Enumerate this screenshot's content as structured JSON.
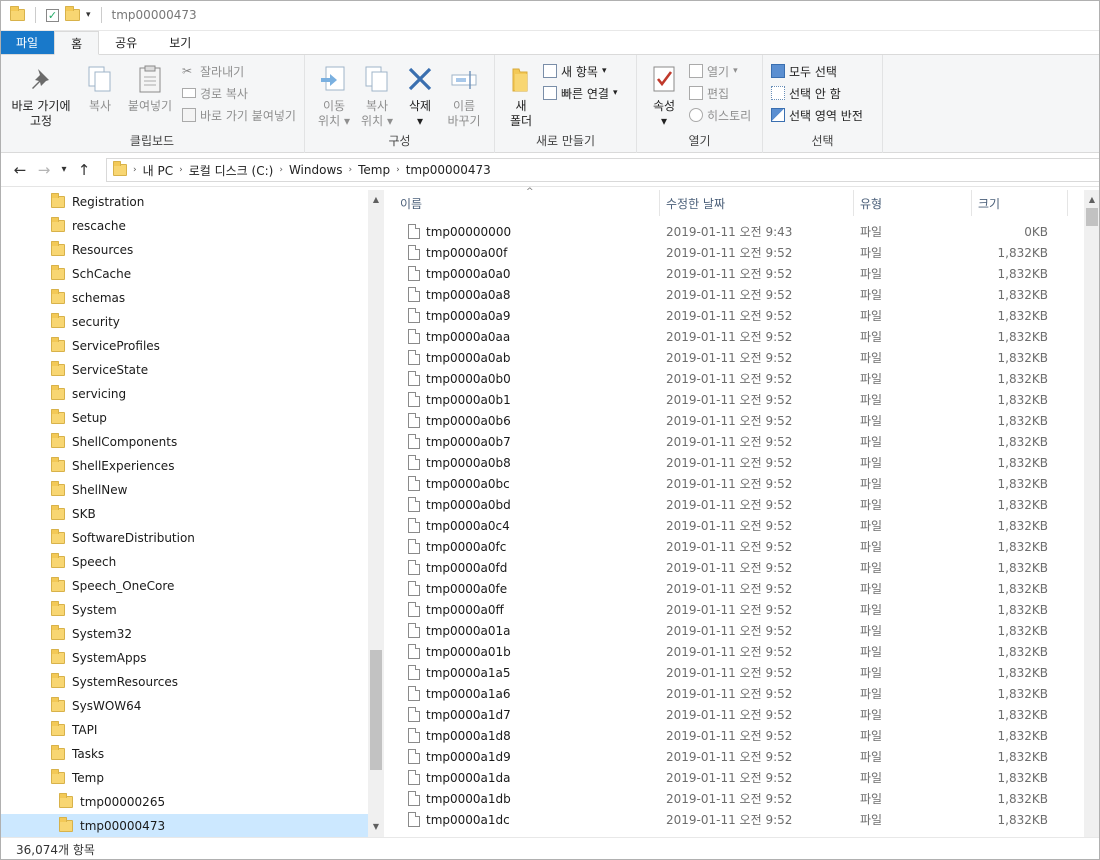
{
  "window": {
    "title": "tmp00000473"
  },
  "tabs": [
    {
      "label": "파일"
    },
    {
      "label": "홈"
    },
    {
      "label": "공유"
    },
    {
      "label": "보기"
    }
  ],
  "ribbon": {
    "clipboard": {
      "label": "클립보드",
      "pin_line1": "바로 가기에",
      "pin_line2": "고정",
      "copy": "복사",
      "paste": "붙여넣기",
      "cut": "잘라내기",
      "copy_path": "경로 복사",
      "paste_shortcut": "바로 가기 붙여넣기"
    },
    "organize": {
      "label": "구성",
      "move_line1": "이동",
      "move_line2": "위치",
      "copyto_line1": "복사",
      "copyto_line2": "위치",
      "delete": "삭제",
      "rename_line1": "이름",
      "rename_line2": "바꾸기"
    },
    "new": {
      "label": "새로 만들기",
      "folder_line1": "새",
      "folder_line2": "폴더",
      "new_item": "새 항목",
      "easy_access": "빠른 연결"
    },
    "open": {
      "label": "열기",
      "properties": "속성",
      "open": "열기",
      "edit": "편집",
      "history": "히스토리"
    },
    "select": {
      "label": "선택",
      "select_all": "모두 선택",
      "select_none": "선택 안 함",
      "invert": "선택 영역 반전"
    }
  },
  "breadcrumb": [
    "내 PC",
    "로컬 디스크 (C:)",
    "Windows",
    "Temp",
    "tmp00000473"
  ],
  "tree": [
    {
      "label": "Registration"
    },
    {
      "label": "rescache"
    },
    {
      "label": "Resources"
    },
    {
      "label": "SchCache"
    },
    {
      "label": "schemas"
    },
    {
      "label": "security"
    },
    {
      "label": "ServiceProfiles"
    },
    {
      "label": "ServiceState"
    },
    {
      "label": "servicing"
    },
    {
      "label": "Setup"
    },
    {
      "label": "ShellComponents"
    },
    {
      "label": "ShellExperiences"
    },
    {
      "label": "ShellNew"
    },
    {
      "label": "SKB"
    },
    {
      "label": "SoftwareDistribution"
    },
    {
      "label": "Speech"
    },
    {
      "label": "Speech_OneCore"
    },
    {
      "label": "System"
    },
    {
      "label": "System32"
    },
    {
      "label": "SystemApps"
    },
    {
      "label": "SystemResources"
    },
    {
      "label": "SysWOW64"
    },
    {
      "label": "TAPI"
    },
    {
      "label": "Tasks"
    },
    {
      "label": "Temp"
    },
    {
      "label": "tmp00000265"
    },
    {
      "label": "tmp00000473"
    }
  ],
  "columns": {
    "name": "이름",
    "date": "수정한 날짜",
    "type": "유형",
    "size": "크기"
  },
  "files": [
    {
      "name": "tmp00000000",
      "date": "2019-01-11 오전 9:43",
      "type": "파일",
      "size": "0KB"
    },
    {
      "name": "tmp0000a00f",
      "date": "2019-01-11 오전 9:52",
      "type": "파일",
      "size": "1,832KB"
    },
    {
      "name": "tmp0000a0a0",
      "date": "2019-01-11 오전 9:52",
      "type": "파일",
      "size": "1,832KB"
    },
    {
      "name": "tmp0000a0a8",
      "date": "2019-01-11 오전 9:52",
      "type": "파일",
      "size": "1,832KB"
    },
    {
      "name": "tmp0000a0a9",
      "date": "2019-01-11 오전 9:52",
      "type": "파일",
      "size": "1,832KB"
    },
    {
      "name": "tmp0000a0aa",
      "date": "2019-01-11 오전 9:52",
      "type": "파일",
      "size": "1,832KB"
    },
    {
      "name": "tmp0000a0ab",
      "date": "2019-01-11 오전 9:52",
      "type": "파일",
      "size": "1,832KB"
    },
    {
      "name": "tmp0000a0b0",
      "date": "2019-01-11 오전 9:52",
      "type": "파일",
      "size": "1,832KB"
    },
    {
      "name": "tmp0000a0b1",
      "date": "2019-01-11 오전 9:52",
      "type": "파일",
      "size": "1,832KB"
    },
    {
      "name": "tmp0000a0b6",
      "date": "2019-01-11 오전 9:52",
      "type": "파일",
      "size": "1,832KB"
    },
    {
      "name": "tmp0000a0b7",
      "date": "2019-01-11 오전 9:52",
      "type": "파일",
      "size": "1,832KB"
    },
    {
      "name": "tmp0000a0b8",
      "date": "2019-01-11 오전 9:52",
      "type": "파일",
      "size": "1,832KB"
    },
    {
      "name": "tmp0000a0bc",
      "date": "2019-01-11 오전 9:52",
      "type": "파일",
      "size": "1,832KB"
    },
    {
      "name": "tmp0000a0bd",
      "date": "2019-01-11 오전 9:52",
      "type": "파일",
      "size": "1,832KB"
    },
    {
      "name": "tmp0000a0c4",
      "date": "2019-01-11 오전 9:52",
      "type": "파일",
      "size": "1,832KB"
    },
    {
      "name": "tmp0000a0fc",
      "date": "2019-01-11 오전 9:52",
      "type": "파일",
      "size": "1,832KB"
    },
    {
      "name": "tmp0000a0fd",
      "date": "2019-01-11 오전 9:52",
      "type": "파일",
      "size": "1,832KB"
    },
    {
      "name": "tmp0000a0fe",
      "date": "2019-01-11 오전 9:52",
      "type": "파일",
      "size": "1,832KB"
    },
    {
      "name": "tmp0000a0ff",
      "date": "2019-01-11 오전 9:52",
      "type": "파일",
      "size": "1,832KB"
    },
    {
      "name": "tmp0000a01a",
      "date": "2019-01-11 오전 9:52",
      "type": "파일",
      "size": "1,832KB"
    },
    {
      "name": "tmp0000a01b",
      "date": "2019-01-11 오전 9:52",
      "type": "파일",
      "size": "1,832KB"
    },
    {
      "name": "tmp0000a1a5",
      "date": "2019-01-11 오전 9:52",
      "type": "파일",
      "size": "1,832KB"
    },
    {
      "name": "tmp0000a1a6",
      "date": "2019-01-11 오전 9:52",
      "type": "파일",
      "size": "1,832KB"
    },
    {
      "name": "tmp0000a1d7",
      "date": "2019-01-11 오전 9:52",
      "type": "파일",
      "size": "1,832KB"
    },
    {
      "name": "tmp0000a1d8",
      "date": "2019-01-11 오전 9:52",
      "type": "파일",
      "size": "1,832KB"
    },
    {
      "name": "tmp0000a1d9",
      "date": "2019-01-11 오전 9:52",
      "type": "파일",
      "size": "1,832KB"
    },
    {
      "name": "tmp0000a1da",
      "date": "2019-01-11 오전 9:52",
      "type": "파일",
      "size": "1,832KB"
    },
    {
      "name": "tmp0000a1db",
      "date": "2019-01-11 오전 9:52",
      "type": "파일",
      "size": "1,832KB"
    },
    {
      "name": "tmp0000a1dc",
      "date": "2019-01-11 오전 9:52",
      "type": "파일",
      "size": "1,832KB"
    }
  ],
  "status": {
    "item_count": "36,074개 항목"
  },
  "colors": {
    "file_tab": "#1979ca",
    "selection": "#cce8ff",
    "folder": "#f8d672"
  }
}
